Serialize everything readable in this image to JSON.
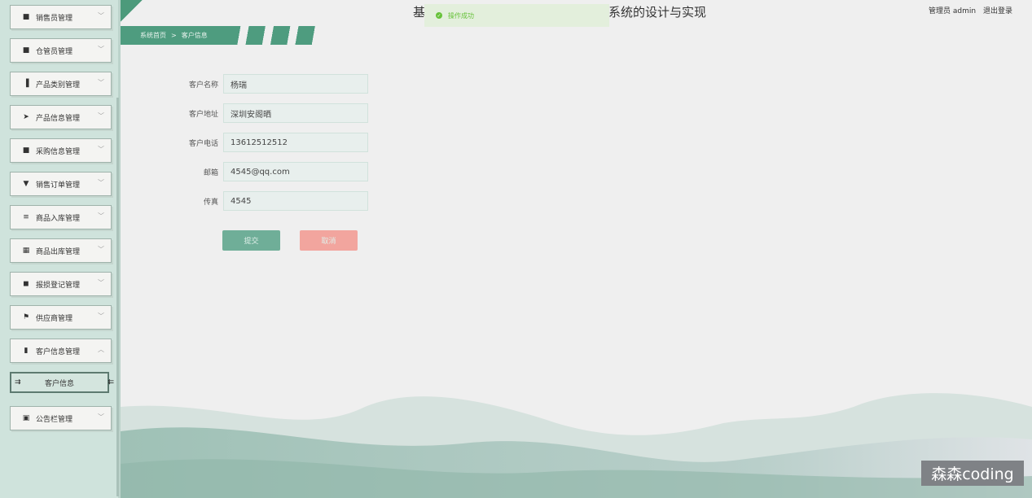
{
  "header": {
    "title_start": "基",
    "title_end": "系统的设计与实现",
    "user": "管理员 admin",
    "logout": "退出登录"
  },
  "toast": {
    "icon": "check-circle-icon",
    "message": "操作成功",
    "color": "#67c23a"
  },
  "breadcrumb": {
    "home": "系统首页",
    "separator": ">",
    "current": "客户信息"
  },
  "sidebar": {
    "items": [
      {
        "label": "销售员管理",
        "icon": "grid-icon"
      },
      {
        "label": "仓管员管理",
        "icon": "grid-icon"
      },
      {
        "label": "产品类别管理",
        "icon": "bar-chart-icon"
      },
      {
        "label": "产品信息管理",
        "icon": "send-icon"
      },
      {
        "label": "采购信息管理",
        "icon": "grid-icon"
      },
      {
        "label": "销售订单管理",
        "icon": "trophy-icon"
      },
      {
        "label": "商品入库管理",
        "icon": "sliders-icon"
      },
      {
        "label": "商品出库管理",
        "icon": "apps-icon"
      },
      {
        "label": "报损登记管理",
        "icon": "camera-icon"
      },
      {
        "label": "供应商管理",
        "icon": "flag-icon"
      },
      {
        "label": "客户信息管理",
        "icon": "book-icon",
        "expanded": true
      }
    ],
    "sub_item": "客户信息",
    "last_item": {
      "label": "公告栏管理",
      "icon": "clipboard-icon"
    }
  },
  "form": {
    "fields": [
      {
        "label": "客户名称",
        "value": "杨瑞"
      },
      {
        "label": "客户地址",
        "value": "深圳安阁晒"
      },
      {
        "label": "客户电话",
        "value": "13612512512"
      },
      {
        "label": "邮箱",
        "value": "4545@qq.com"
      },
      {
        "label": "传真",
        "value": "4545"
      }
    ],
    "submit": "提交",
    "cancel": "取消",
    "submit_color": "#6fae98",
    "cancel_color": "#f2a59e"
  },
  "watermark": "森森coding"
}
